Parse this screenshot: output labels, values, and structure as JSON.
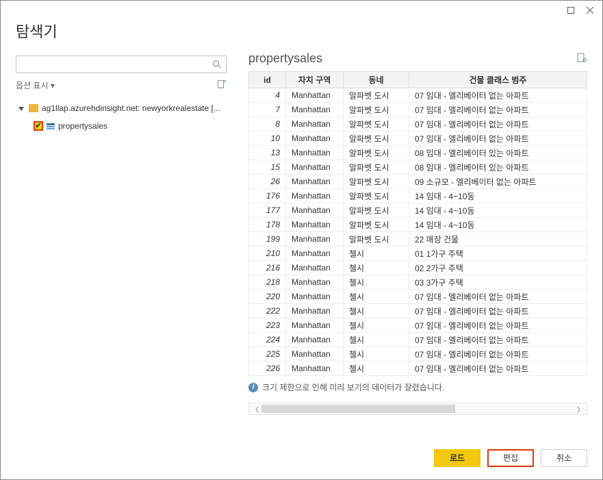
{
  "window": {
    "title": "탐색기"
  },
  "left": {
    "optionsLabel": "옵션 표시",
    "datasource": "ag1llap.azurehdinsight.net: newyorkrealestate [...",
    "tableName": "propertysales"
  },
  "right": {
    "title": "propertysales",
    "columns": [
      "id",
      "자치 구역",
      "동네",
      "건물 클래스 범주"
    ],
    "rows": [
      {
        "id": "4",
        "bor": "Manhattan",
        "hood": "알파벳 도시",
        "cls": "07 임대 - 엘리베이터 없는 아파트"
      },
      {
        "id": "7",
        "bor": "Manhattan",
        "hood": "알파벳 도시",
        "cls": "07 임대 - 엘리베이터 없는 아파트"
      },
      {
        "id": "8",
        "bor": "Manhattan",
        "hood": "알파벳 도시",
        "cls": "07 임대 - 엘리베이터 없는 아파트"
      },
      {
        "id": "10",
        "bor": "Manhattan",
        "hood": "알파벳 도시",
        "cls": "07 임대 - 엘리베이터 없는 아파트"
      },
      {
        "id": "13",
        "bor": "Manhattan",
        "hood": "알파벳 도시",
        "cls": "08 임대 - 엘리베이터 있는 아파트"
      },
      {
        "id": "15",
        "bor": "Manhattan",
        "hood": "알파벳 도시",
        "cls": "08 임대 - 엘리베이터 있는 아파트"
      },
      {
        "id": "26",
        "bor": "Manhattan",
        "hood": "알파벳 도시",
        "cls": "09 소규모 - 엘리베이터 없는 아파트"
      },
      {
        "id": "176",
        "bor": "Manhattan",
        "hood": "알파벳 도시",
        "cls": "14 임대 - 4~10동"
      },
      {
        "id": "177",
        "bor": "Manhattan",
        "hood": "알파벳 도시",
        "cls": "14 임대 - 4~10동"
      },
      {
        "id": "178",
        "bor": "Manhattan",
        "hood": "알파벳 도시",
        "cls": "14 임대 - 4~10동"
      },
      {
        "id": "199",
        "bor": "Manhattan",
        "hood": "알파벳 도시",
        "cls": "22 매장 건물"
      },
      {
        "id": "210",
        "bor": "Manhattan",
        "hood": "첼시",
        "cls": "01 1가구 주택"
      },
      {
        "id": "216",
        "bor": "Manhattan",
        "hood": "첼시",
        "cls": "02 2가구 주택"
      },
      {
        "id": "218",
        "bor": "Manhattan",
        "hood": "첼시",
        "cls": "03 3가구 주택"
      },
      {
        "id": "220",
        "bor": "Manhattan",
        "hood": "첼시",
        "cls": "07 임대 - 엘리베이터 없는 아파트"
      },
      {
        "id": "222",
        "bor": "Manhattan",
        "hood": "첼시",
        "cls": "07 임대 - 엘리베이터 없는 아파트"
      },
      {
        "id": "223",
        "bor": "Manhattan",
        "hood": "첼시",
        "cls": "07 임대 - 엘리베이터 없는 아파트"
      },
      {
        "id": "224",
        "bor": "Manhattan",
        "hood": "첼시",
        "cls": "07 임대 - 엘리베이터 없는 아파트"
      },
      {
        "id": "225",
        "bor": "Manhattan",
        "hood": "첼시",
        "cls": "07 임대 - 엘리베이터 없는 아파트"
      },
      {
        "id": "226",
        "bor": "Manhattan",
        "hood": "첼시",
        "cls": "07 임대 - 엘리베이터 없는 아파트"
      }
    ],
    "infoMessage": "크기 제한으로 인해 미리 보기의 데이터가 잘렸습니다."
  },
  "footer": {
    "load": "로드",
    "edit": "편집",
    "cancel": "취소"
  }
}
